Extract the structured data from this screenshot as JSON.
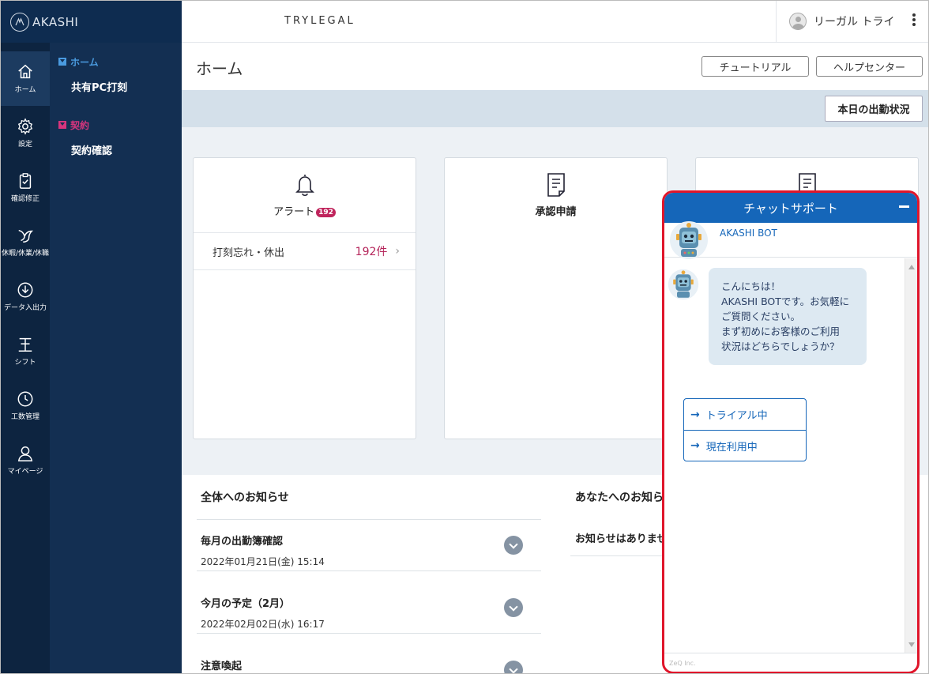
{
  "app": {
    "brand": "AKASHI"
  },
  "rail": {
    "items": [
      {
        "label": "ホーム",
        "icon": "home-icon"
      },
      {
        "label": "設定",
        "icon": "gear-icon"
      },
      {
        "label": "確認修正",
        "icon": "clipboard-check-icon"
      },
      {
        "label": "休暇/休業/休職",
        "icon": "bird-icon"
      },
      {
        "label": "データ入出力",
        "icon": "download-circle-icon"
      },
      {
        "label": "シフト",
        "icon": "shift-icon"
      },
      {
        "label": "工数管理",
        "icon": "clock-icon"
      },
      {
        "label": "マイページ",
        "icon": "person-icon"
      }
    ]
  },
  "submenu": {
    "home_group": "ホーム",
    "home_link": "共有PC打刻",
    "contract_group": "契約",
    "contract_link": "契約確認"
  },
  "topbar": {
    "company": "TRYLEGAL",
    "user_name": "リーガル トライ"
  },
  "page": {
    "title": "ホーム",
    "tutorial_button": "チュートリアル",
    "help_button": "ヘルプセンター",
    "today_button": "本日の出勤状況"
  },
  "cards": {
    "alert_title": "アラート",
    "alert_badge": "192",
    "alert_row_label": "打刻忘れ・休出",
    "alert_row_count": "192件",
    "approval_title": "承認申請"
  },
  "notices": {
    "all_title": "全体へのお知らせ",
    "yours_title": "あなたへのお知らせ",
    "yours_empty": "お知らせはありません",
    "items": [
      {
        "title": "毎月の出勤簿確認",
        "date": "2022年01月21日(金) 15:14"
      },
      {
        "title": "今月の予定（2月）",
        "date": "2022年02月02日(水) 16:17"
      },
      {
        "title": "注意喚起",
        "date": ""
      }
    ]
  },
  "chat": {
    "header": "チャットサポート",
    "bot_name": "AKASHI BOT",
    "message_lines": [
      "こんにちは！",
      "AKASHI BOTです。お気軽に",
      "ご質問ください。",
      "まず初めにお客様のご利用",
      "状況はどちらでしょうか？"
    ],
    "options": [
      "トライアル中",
      "現在利用中"
    ],
    "footer": "ZeQ Inc."
  },
  "colors": {
    "rail_bg": "#0d2440",
    "submenu_bg": "#132f52",
    "home_accent": "#4a9be0",
    "contract_accent": "#d6357d",
    "alert_badge": "#c0245c",
    "chat_header": "#1566b9",
    "highlight_border": "#e0162b"
  }
}
